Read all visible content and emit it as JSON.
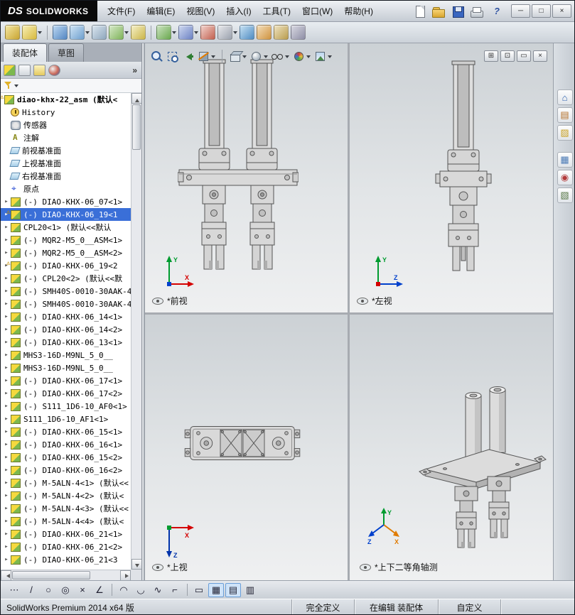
{
  "titlebar": {
    "logo": {
      "mark": "DS",
      "name": "SOLIDWORKS"
    },
    "menus": [
      {
        "label": "文件(F)"
      },
      {
        "label": "编辑(E)"
      },
      {
        "label": "视图(V)"
      },
      {
        "label": "插入(I)"
      },
      {
        "label": "工具(T)"
      },
      {
        "label": "窗口(W)"
      },
      {
        "label": "帮助(H)"
      }
    ],
    "quick": [
      {
        "name": "new-document-icon",
        "cls": "page",
        "glyph": ""
      },
      {
        "name": "open-document-icon",
        "cls": "open has-arrow",
        "glyph": ""
      },
      {
        "name": "save-icon",
        "cls": "save has-arrow",
        "glyph": ""
      },
      {
        "name": "print-icon",
        "cls": "print has-arrow",
        "glyph": ""
      },
      {
        "name": "help-icon",
        "cls": "help",
        "glyph": "?"
      }
    ],
    "window_controls": [
      {
        "name": "minimize-button",
        "glyph": "─"
      },
      {
        "name": "maximize-button",
        "glyph": "□"
      },
      {
        "name": "close-button",
        "glyph": "×"
      }
    ]
  },
  "toolbar": {
    "icons": [
      {
        "name": "edit-component-icon",
        "cls": "",
        "c1": "#f4e7a2",
        "c2": "#c9a532"
      },
      {
        "name": "insert-components-icon",
        "cls": "has-arrow",
        "c1": "#f7efb5",
        "c2": "#d7b93f"
      },
      {
        "name": "toolbar-separator",
        "cls": "sep"
      },
      {
        "name": "mate-icon",
        "cls": "",
        "c1": "#bcd8f2",
        "c2": "#5487c2"
      },
      {
        "name": "linear-component-pattern-icon",
        "cls": "has-arrow",
        "c1": "#cfe4f5",
        "c2": "#6fa0cf"
      },
      {
        "name": "smart-fasteners-icon",
        "cls": "",
        "c1": "#dbe6ef",
        "c2": "#8fa7bd"
      },
      {
        "name": "move-component-icon",
        "cls": "has-arrow",
        "c1": "#d7e9c9",
        "c2": "#7fb45a"
      },
      {
        "name": "show-hidden-components-icon",
        "cls": "",
        "c1": "#f5f0c8",
        "c2": "#cbb64a"
      },
      {
        "name": "toolbar-separator",
        "cls": "sep"
      },
      {
        "name": "assembly-features-icon",
        "cls": "has-arrow",
        "c1": "#cde4c2",
        "c2": "#6aa84f"
      },
      {
        "name": "reference-geometry-icon",
        "cls": "has-arrow",
        "c1": "#cfd9f0",
        "c2": "#6c82c4"
      },
      {
        "name": "new-motion-study-icon",
        "cls": "",
        "c1": "#f2d3cd",
        "c2": "#c2604f"
      },
      {
        "name": "bill-of-materials-icon",
        "cls": "has-arrow",
        "c1": "#e8e9ec",
        "c2": "#9ba2ae"
      },
      {
        "name": "exploded-view-icon",
        "cls": "",
        "c1": "#c7e2f4",
        "c2": "#4f8cc2"
      },
      {
        "name": "interference-detection-icon",
        "cls": "",
        "c1": "#f4deba",
        "c2": "#cf9440"
      },
      {
        "name": "measure-icon",
        "cls": "",
        "c1": "#efe3c2",
        "c2": "#b99d4e"
      },
      {
        "name": "section-properties-icon",
        "cls": "",
        "c1": "#d9d9e2",
        "c2": "#8e8ea6"
      }
    ]
  },
  "panel": {
    "tabs": [
      {
        "label": "装配体"
      },
      {
        "label": "草图"
      }
    ],
    "manager_icons": [
      {
        "name": "featuremanager-tree-icon",
        "cls": "fm"
      },
      {
        "name": "propertymanager-icon",
        "cls": "pm"
      },
      {
        "name": "configurationmanager-icon",
        "cls": "cm"
      },
      {
        "name": "displaymanager-icon",
        "cls": "dm"
      }
    ],
    "overflow_label": "»"
  },
  "tree": {
    "items": [
      {
        "label": "diao-khx-22_asm (默认<",
        "icon": "asm",
        "flags": "lvl0 warn bold"
      },
      {
        "label": "History",
        "icon": "history",
        "flags": "lvl1"
      },
      {
        "label": "传感器",
        "icon": "sensors",
        "flags": "lvl1"
      },
      {
        "label": "注解",
        "icon": "annotations",
        "flags": "lvl1"
      },
      {
        "label": "前视基准面",
        "icon": "plane",
        "flags": "lvl1"
      },
      {
        "label": "上视基准面",
        "icon": "plane",
        "flags": "lvl1"
      },
      {
        "label": "右视基准面",
        "icon": "plane",
        "flags": "lvl1"
      },
      {
        "label": "原点",
        "icon": "origin",
        "flags": "lvl1"
      },
      {
        "label": "(-) DIAO-KHX-06_07<1>",
        "icon": "asm",
        "flags": "lvl1 has-arrow"
      },
      {
        "label": "(-) DIAO-KHX-06_19<1",
        "icon": "asm",
        "flags": "lvl1 has-arrow warn selected"
      },
      {
        "label": "CPL20<1> (默认<<默认",
        "icon": "asm",
        "flags": "lvl1 has-arrow"
      },
      {
        "label": "(-) MQR2-M5_0__ASM<1>",
        "icon": "asm",
        "flags": "lvl1 has-arrow"
      },
      {
        "label": "(-) MQR2-M5_0__ASM<2>",
        "icon": "asm",
        "flags": "lvl1 has-arrow"
      },
      {
        "label": "(-) DIAO-KHX-06_19<2",
        "icon": "asm",
        "flags": "lvl1 has-arrow warn"
      },
      {
        "label": "(-) CPL20<2> (默认<<默",
        "icon": "asm",
        "flags": "lvl1 has-arrow"
      },
      {
        "label": "(-) SMH40S-0010-30AAK-4",
        "icon": "asm",
        "flags": "lvl1 has-arrow"
      },
      {
        "label": "(-) SMH40S-0010-30AAK-4",
        "icon": "asm",
        "flags": "lvl1 has-arrow"
      },
      {
        "label": "(-) DIAO-KHX-06_14<1>",
        "icon": "asm",
        "flags": "lvl1 has-arrow"
      },
      {
        "label": "(-) DIAO-KHX-06_14<2>",
        "icon": "asm",
        "flags": "lvl1 has-arrow"
      },
      {
        "label": "(-) DIAO-KHX-06_13<1>",
        "icon": "asm",
        "flags": "lvl1 has-arrow"
      },
      {
        "label": "MHS3-16D-M9NL_5_0__",
        "icon": "asm",
        "flags": "lvl1 has-arrow"
      },
      {
        "label": "MHS3-16D-M9NL_5_0__",
        "icon": "asm",
        "flags": "lvl1 has-arrow"
      },
      {
        "label": "(-) DIAO-KHX-06_17<1>",
        "icon": "asm",
        "flags": "lvl1 has-arrow"
      },
      {
        "label": "(-) DIAO-KHX-06_17<2>",
        "icon": "asm",
        "flags": "lvl1 has-arrow"
      },
      {
        "label": "(-) S111_1D6-10_AF0<1>",
        "icon": "asm",
        "flags": "lvl1 has-arrow"
      },
      {
        "label": "S111_1D6-10_AF1<1>",
        "icon": "asm",
        "flags": "lvl1 has-arrow"
      },
      {
        "label": "(-) DIAO-KHX-06_15<1>",
        "icon": "asm",
        "flags": "lvl1 has-arrow"
      },
      {
        "label": "(-) DIAO-KHX-06_16<1>",
        "icon": "asm",
        "flags": "lvl1 has-arrow"
      },
      {
        "label": "(-) DIAO-KHX-06_15<2>",
        "icon": "asm",
        "flags": "lvl1 has-arrow"
      },
      {
        "label": "(-) DIAO-KHX-06_16<2>",
        "icon": "asm",
        "flags": "lvl1 has-arrow"
      },
      {
        "label": "(-) M-5ALN-4<1> (默认<<",
        "icon": "asm",
        "flags": "lvl1 has-arrow"
      },
      {
        "label": "(-) M-5ALN-4<2> (默认<",
        "icon": "asm",
        "flags": "lvl1 has-arrow"
      },
      {
        "label": "(-) M-5ALN-4<3> (默认<<",
        "icon": "asm",
        "flags": "lvl1 has-arrow"
      },
      {
        "label": "(-) M-5ALN-4<4> (默认<",
        "icon": "asm",
        "flags": "lvl1 has-arrow"
      },
      {
        "label": "(-) DIAO-KHX-06_21<1>",
        "icon": "asm",
        "flags": "lvl1 has-arrow"
      },
      {
        "label": "(-) DIAO-KHX-06_21<2>",
        "icon": "asm",
        "flags": "lvl1 has-arrow"
      },
      {
        "label": "(-) DIAO-KHX-06_21<3",
        "icon": "asm",
        "flags": "lvl1 has-arrow"
      }
    ]
  },
  "viewport": {
    "hud": [
      {
        "name": "zoom-to-fit-icon",
        "cls": "zoomfit"
      },
      {
        "name": "zoom-to-area-icon",
        "cls": "zoomarea"
      },
      {
        "name": "previous-view-icon",
        "cls": "prev"
      },
      {
        "name": "section-view-icon",
        "cls": "section has-arrow"
      },
      {
        "name": "hud-separator",
        "cls": "sep"
      },
      {
        "name": "view-orientation-icon",
        "cls": "orient has-arrow"
      },
      {
        "name": "display-style-icon",
        "cls": "display has-arrow"
      },
      {
        "name": "hide-show-items-icon",
        "cls": "hideshow has-arrow"
      },
      {
        "name": "edit-appearance-icon",
        "cls": "appearance has-arrow"
      },
      {
        "name": "apply-scene-icon",
        "cls": "scene has-arrow"
      }
    ],
    "controls": [
      {
        "name": "viewport-layout-button",
        "glyph": "⊞"
      },
      {
        "name": "viewport-single-button",
        "glyph": "⊡"
      },
      {
        "name": "restore-document-button",
        "glyph": "▭"
      },
      {
        "name": "close-document-button",
        "glyph": "×"
      }
    ],
    "views": [
      {
        "label": "*前视",
        "triad": {
          "up": "Y",
          "right": "X",
          "up_color": "#009b2f",
          "right_color": "#d40000",
          "depth_color": "#0040cc"
        }
      },
      {
        "label": "*左视",
        "triad": {
          "up": "Y",
          "right": "Z",
          "up_color": "#009b2f",
          "right_color": "#0040cc",
          "depth_color": "#d40000"
        }
      },
      {
        "label": "*上视",
        "triad": {
          "right": "X",
          "down": "Z",
          "right_color": "#d40000",
          "down_color": "#0033aa",
          "depth_color": "#009b2f"
        }
      },
      {
        "label": "*上下二等角轴测",
        "triad": {
          "up": "Y",
          "se": "X",
          "sw": "Z",
          "up_color": "#009b2f",
          "se_color": "#e07b00",
          "sw_color": "#0040cc"
        }
      }
    ]
  },
  "taskpane": {
    "icons": [
      {
        "name": "solidworks-resources-icon",
        "glyph": "⌂",
        "color": "#2b5fae",
        "cls": ""
      },
      {
        "name": "design-library-icon",
        "glyph": "▤",
        "color": "#b5712a",
        "cls": ""
      },
      {
        "name": "file-explorer-icon",
        "glyph": "▨",
        "color": "#c9a227",
        "cls": ""
      },
      {
        "name": "view-palette-icon",
        "glyph": "▦",
        "color": "#4a7ab5",
        "cls": "gap"
      },
      {
        "name": "appearances-scenes-icon",
        "glyph": "◉",
        "color": "#b33a3a",
        "cls": ""
      },
      {
        "name": "custom-properties-icon",
        "glyph": "▧",
        "color": "#5a7a4a",
        "cls": ""
      }
    ]
  },
  "sketchbar": {
    "icons": [
      {
        "name": "sketch-points-icon",
        "glyph": "⋯",
        "cls": ""
      },
      {
        "name": "sketch-line-icon",
        "glyph": "/",
        "cls": ""
      },
      {
        "name": "sketch-circle-icon",
        "glyph": "○",
        "cls": ""
      },
      {
        "name": "sketch-perimeter-circle-icon",
        "glyph": "◎",
        "cls": ""
      },
      {
        "name": "sketch-cross-icon",
        "glyph": "×",
        "cls": ""
      },
      {
        "name": "sketch-angle-icon",
        "glyph": "∠",
        "cls": ""
      },
      {
        "name": "sketchbar-separator",
        "glyph": "",
        "cls": "sep"
      },
      {
        "name": "sketch-arc-icon",
        "glyph": "◠",
        "cls": ""
      },
      {
        "name": "sketch-tangent-arc-icon",
        "glyph": "◡",
        "cls": ""
      },
      {
        "name": "sketch-spline-icon",
        "glyph": "∿",
        "cls": ""
      },
      {
        "name": "sketch-fillet-icon",
        "glyph": "⌐",
        "cls": ""
      },
      {
        "name": "sketchbar-separator",
        "glyph": "",
        "cls": "sep"
      },
      {
        "name": "sketch-rectangle-icon",
        "glyph": "▭",
        "cls": ""
      },
      {
        "name": "grid-snap-icon",
        "glyph": "▦",
        "cls": "pressed"
      },
      {
        "name": "snap-settings-icon",
        "glyph": "▤",
        "cls": "pressed"
      },
      {
        "name": "evaluate-table-icon",
        "glyph": "▥",
        "cls": ""
      }
    ]
  },
  "statusbar": {
    "product": "SolidWorks Premium 2014 x64 版",
    "defined_state": "完全定义",
    "editing_state": "在编辑 装配体",
    "custom_label": "自定义"
  }
}
